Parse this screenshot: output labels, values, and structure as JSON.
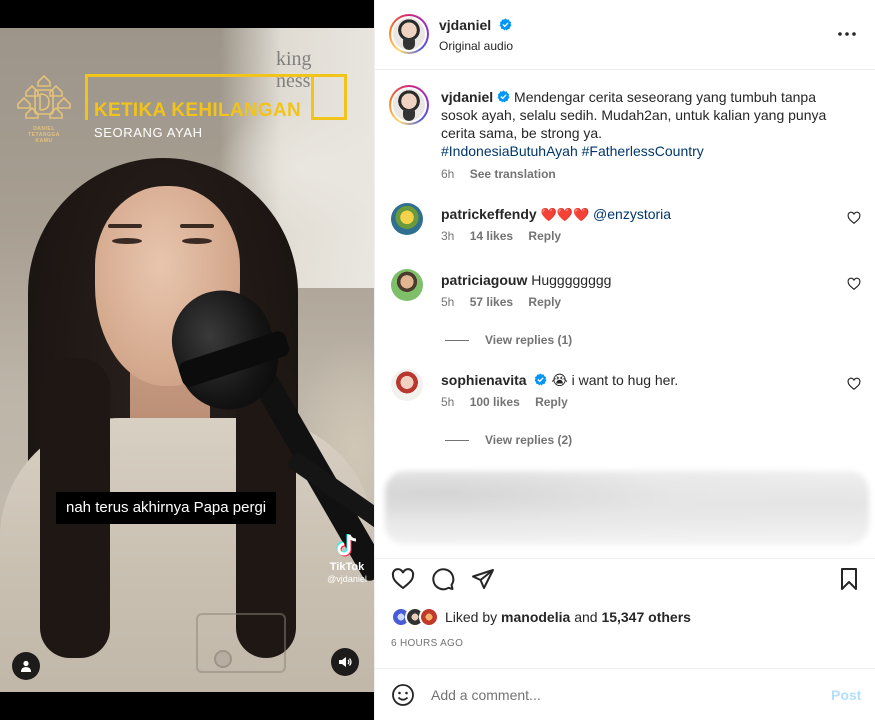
{
  "video": {
    "title_main": "KETIKA KEHILANGAN",
    "title_sub": "SEORANG AYAH",
    "brand_text": "DANIEL\nTETANGGA\nKAMU",
    "subtitle": "nah terus akhirnya Papa pergi",
    "watermark_name": "TikTok",
    "watermark_handle": "@vjdaniel",
    "accent_color": "#f2c318"
  },
  "header": {
    "username": "vjdaniel",
    "audio": "Original audio"
  },
  "caption": {
    "username": "vjdaniel",
    "text": "Mendengar cerita seseorang yang tumbuh tanpa sosok ayah, selalu sedih. Mudah2an, untuk kalian yang punya cerita sama, be strong ya.",
    "hashtags": "#IndonesiaButuhAyah #FatherlessCountry",
    "time": "6h",
    "translate": "See translation"
  },
  "comments": [
    {
      "username": "patrickeffendy",
      "text": "",
      "emoji": "❤️❤️❤️",
      "mention": "@enzystoria",
      "time": "3h",
      "likes": "14 likes",
      "reply": "Reply"
    },
    {
      "username": "patriciagouw",
      "text": "Hugggggggg",
      "time": "5h",
      "likes": "57 likes",
      "reply": "Reply",
      "view_replies": "View replies (1)"
    },
    {
      "username": "sophienavita",
      "emoji": "😭",
      "text": "i want to hug her.",
      "time": "5h",
      "likes": "100 likes",
      "reply": "Reply",
      "view_replies": "View replies (2)"
    }
  ],
  "likes": {
    "prefix": "Liked by",
    "user": "manodelia",
    "joiner": "and",
    "others": "15,347 others"
  },
  "post_time": "6 HOURS AGO",
  "comment_box": {
    "placeholder": "Add a comment...",
    "post_label": "Post"
  },
  "icons": {
    "verified": "verified-badge-icon",
    "more": "more-options-icon",
    "like": "heart-icon",
    "comment": "comment-icon",
    "share": "send-icon",
    "save": "bookmark-icon",
    "emoji": "emoji-icon",
    "user": "user-icon",
    "sound": "speaker-icon"
  },
  "colors": {
    "verified_blue": "#0095f6",
    "link_blue": "#00376b",
    "post_disabled": "#b2dffc",
    "heart_red": "#ed4956"
  }
}
